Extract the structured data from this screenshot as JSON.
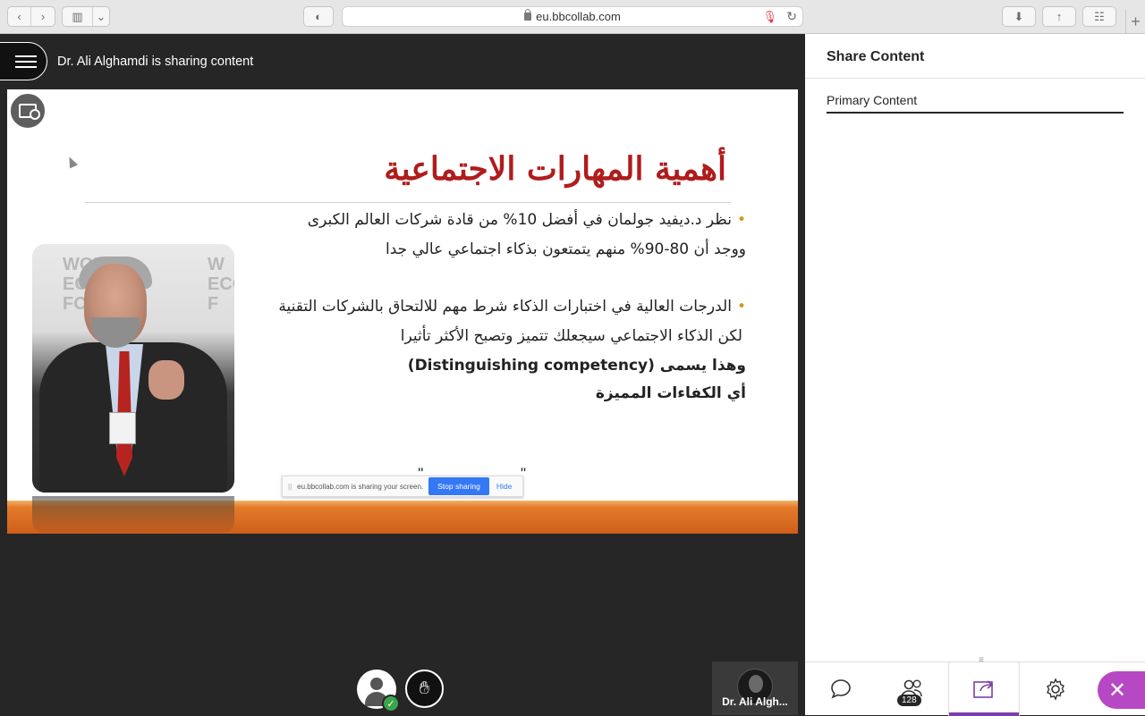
{
  "browser": {
    "url": "eu.bbcollab.com",
    "plus_label": "+"
  },
  "header": {
    "sharing_title": "Dr. Ali Alghamdi is sharing content"
  },
  "slide": {
    "title": "أهمية المهارات الاجتماعية",
    "lines": [
      "نظر د.ديفيد جولمان في أفضل 10% من قادة شركات العالم الكبرى",
      "ووجد أن 80-90% منهم يتمتعون بذكاء اجتماعي عالي جدا",
      "الدرجات العالية في اختبارات الذكاء شرط مهم للالتحاق بالشركات التقنية",
      "لكن الذكاء الاجتماعي سيجعلك تتميز وتصبح الأكثر تأثيرا",
      "وهذا يسمى (Distinguishing competency)",
      "أي الكفاءات المميزة"
    ],
    "cut_text": "\"... ... ... ... ... ...\"",
    "photo_watermark_1": "WORLD\nECONO\nFO",
    "photo_watermark_2": "W\nECO\nF"
  },
  "share_notice": {
    "message": "eu.bbcollab.com is sharing your screen.",
    "stop_label": "Stop sharing",
    "hide_label": "Hide"
  },
  "presenter": {
    "name": "Dr. Ali Algh..."
  },
  "panel": {
    "title": "Share Content",
    "primary_label": "Primary Content",
    "participant_count": "128"
  },
  "colors": {
    "accent": "#7b3fa8",
    "close": "#b748c4",
    "slide_title": "#b01c1c",
    "bullet": "#d4961e"
  }
}
